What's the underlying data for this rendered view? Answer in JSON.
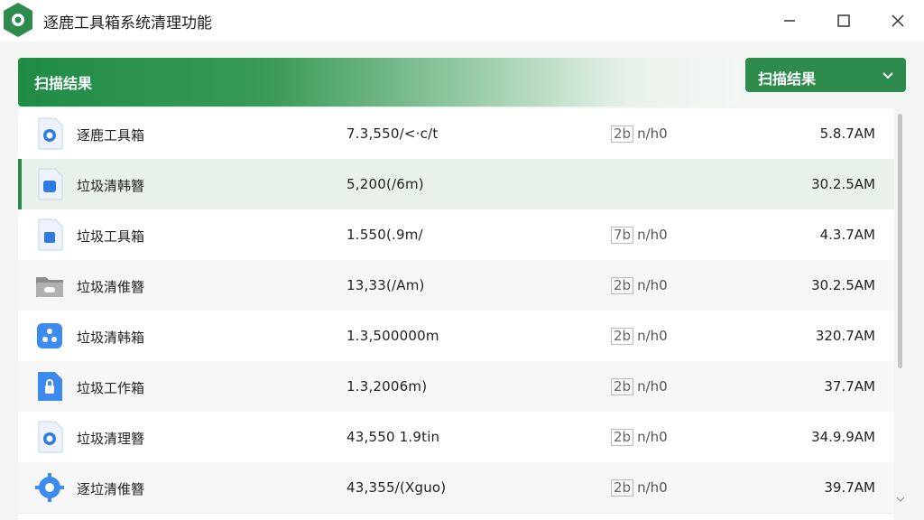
{
  "window": {
    "title": "逐鹿工具箱系统清理功能",
    "controls": [
      "minimize-icon",
      "maximize-icon",
      "close-icon"
    ]
  },
  "header": {
    "title": "扫描结果"
  },
  "dropdown": {
    "selected": "扫描结果",
    "icon": "chevron-down-icon"
  },
  "colors": {
    "accent": "#2e8b4e",
    "selected_row": "#e9f2ea"
  },
  "files": [
    {
      "icon": "search-doc-icon",
      "name": "逐鹿工具箱",
      "size": "7.3,550/<·c/t",
      "meta_box": "2b",
      "meta": "n/h0",
      "time": "5.8.7AM"
    },
    {
      "icon": "doc-icon",
      "name": "垃圾清韩簪",
      "size": "5,200(/6m)",
      "meta_box": "",
      "meta": "",
      "time": "30.2.5AM",
      "selected": true
    },
    {
      "icon": "lock-doc-icon",
      "name": "垃圾工具箱",
      "size": "1.550(.9m/",
      "meta_box": "7b",
      "meta": "n/h0",
      "time": "4.3.7AM"
    },
    {
      "icon": "folder-icon",
      "name": "垃圾清倠簪",
      "size": "13,33(/Am)",
      "meta_box": "2b",
      "meta": "n/h0",
      "time": "30.2.5AM"
    },
    {
      "icon": "app-icon",
      "name": "垃圾清韩箱",
      "size": "1.3,500000m",
      "meta_box": "2b",
      "meta": "n/h0",
      "time": "320.7AM"
    },
    {
      "icon": "lock-icon",
      "name": "垃圾工作箱",
      "size": "1.3,2006m)",
      "meta_box": "2b",
      "meta": "n/h0",
      "time": "37.7AM"
    },
    {
      "icon": "search-doc-icon",
      "name": "垃圾清理簪",
      "size": "43,550 1.9tin",
      "meta_box": "2b",
      "meta": "n/h0",
      "time": "34.9.9AM"
    },
    {
      "icon": "gear-icon",
      "name": "逐垃清倠簪",
      "size": "43,355/(Xguo)",
      "meta_box": "2b",
      "meta": "n/h0",
      "time": "39.7AM"
    }
  ]
}
